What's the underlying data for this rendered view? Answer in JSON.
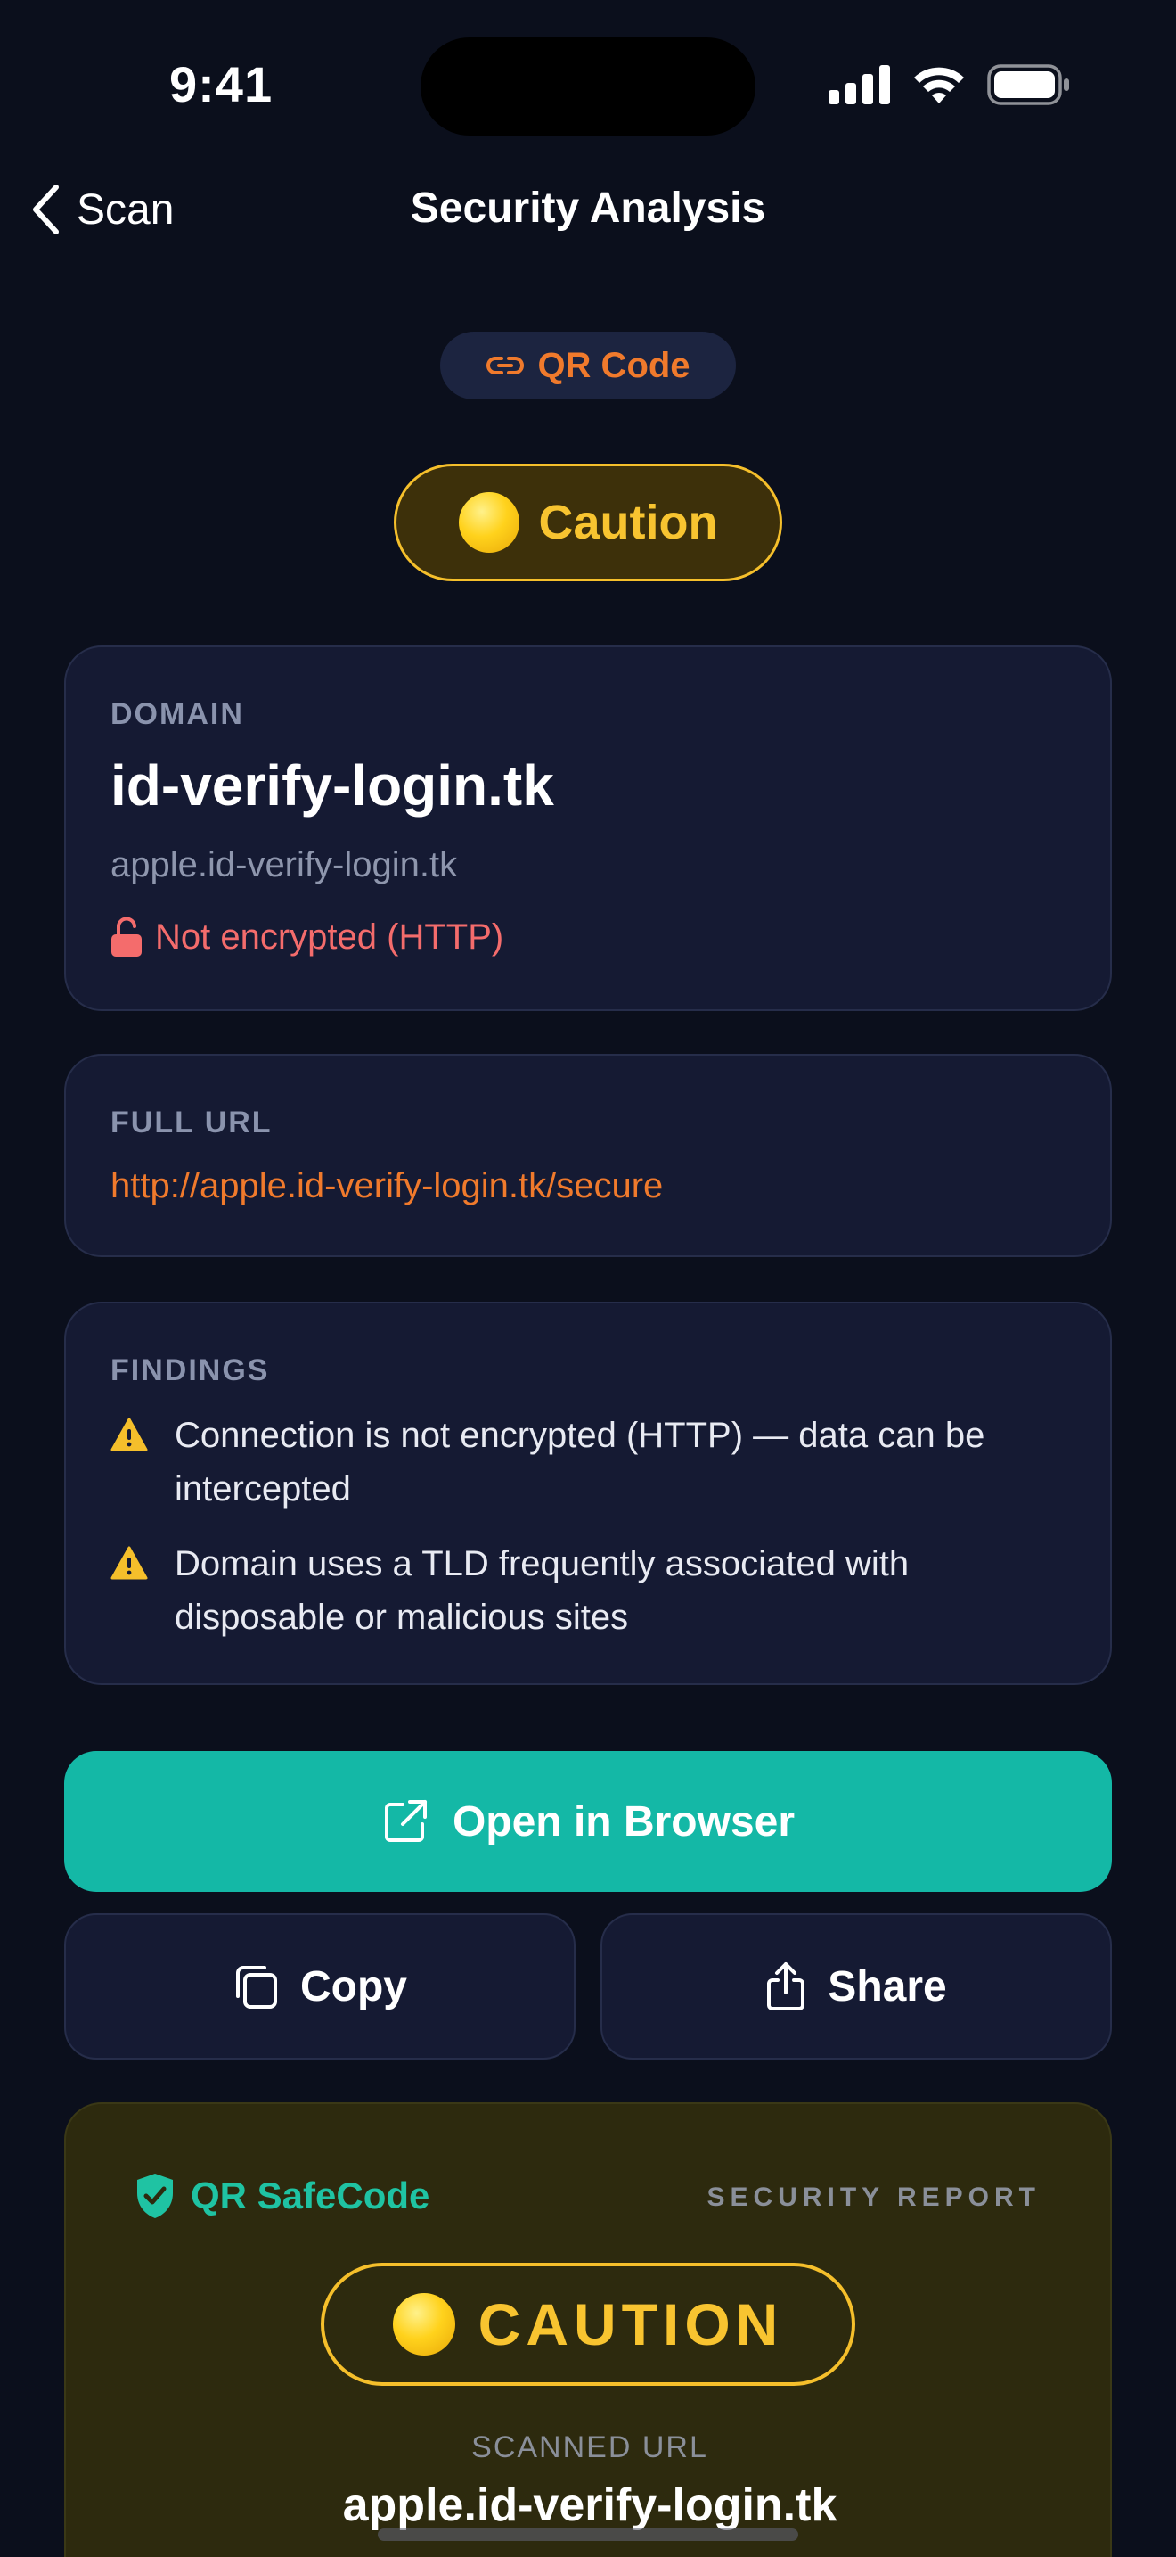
{
  "status_bar": {
    "time": "9:41"
  },
  "nav": {
    "back_label": "Scan",
    "title": "Security Analysis"
  },
  "source": {
    "label": "QR Code",
    "icon": "link-icon"
  },
  "verdict": {
    "label": "Caution",
    "color": "#f8c430"
  },
  "domain_card": {
    "label": "DOMAIN",
    "domain": "id-verify-login.tk",
    "subdomain": "apple.id-verify-login.tk",
    "encryption": "Not encrypted (HTTP)"
  },
  "url_card": {
    "label": "FULL URL",
    "url": "http://apple.id-verify-login.tk/secure"
  },
  "findings": {
    "label": "FINDINGS",
    "items": [
      "Connection is not encrypted (HTTP) — data can be intercepted",
      "Domain uses a TLD frequently associated with disposable or malicious sites"
    ]
  },
  "actions": {
    "open_label": "Open in Browser",
    "copy_label": "Copy",
    "share_label": "Share"
  },
  "report": {
    "brand": "QR SafeCode",
    "tag": "SECURITY REPORT",
    "verdict": "CAUTION",
    "scanned_label": "SCANNED URL",
    "scanned_url": "apple.id-verify-login.tk"
  },
  "colors": {
    "background": "#0b0f1c",
    "card": "#151a33",
    "accent": "#14b8a6",
    "warning": "#f5bf2b",
    "danger": "#f46c6c",
    "link": "#f07a2c"
  }
}
